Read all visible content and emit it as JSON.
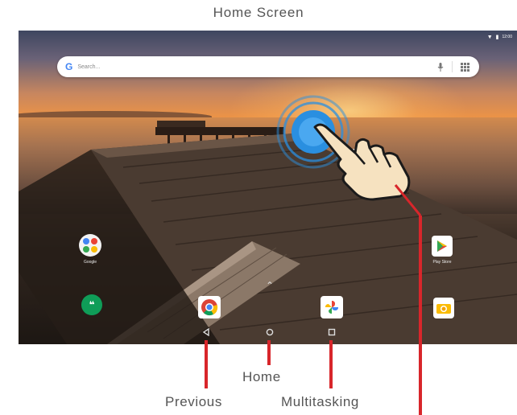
{
  "title": "Home Screen",
  "search": {
    "placeholder": "Search..."
  },
  "clock": {
    "time_partial": "00"
  },
  "apps": {
    "google": "Google",
    "play_store": "Play Store"
  },
  "callouts": {
    "home": "Home",
    "previous": "Previous",
    "multitasking": "Multitasking"
  },
  "colors": {
    "callout_line": "#d8262b",
    "touch_ring": "#2a8fe0"
  },
  "icons": [
    "search-g-logo",
    "mic-icon",
    "apps-grid-icon",
    "back-icon",
    "home-icon",
    "recents-icon",
    "hand-pointer-icon"
  ]
}
